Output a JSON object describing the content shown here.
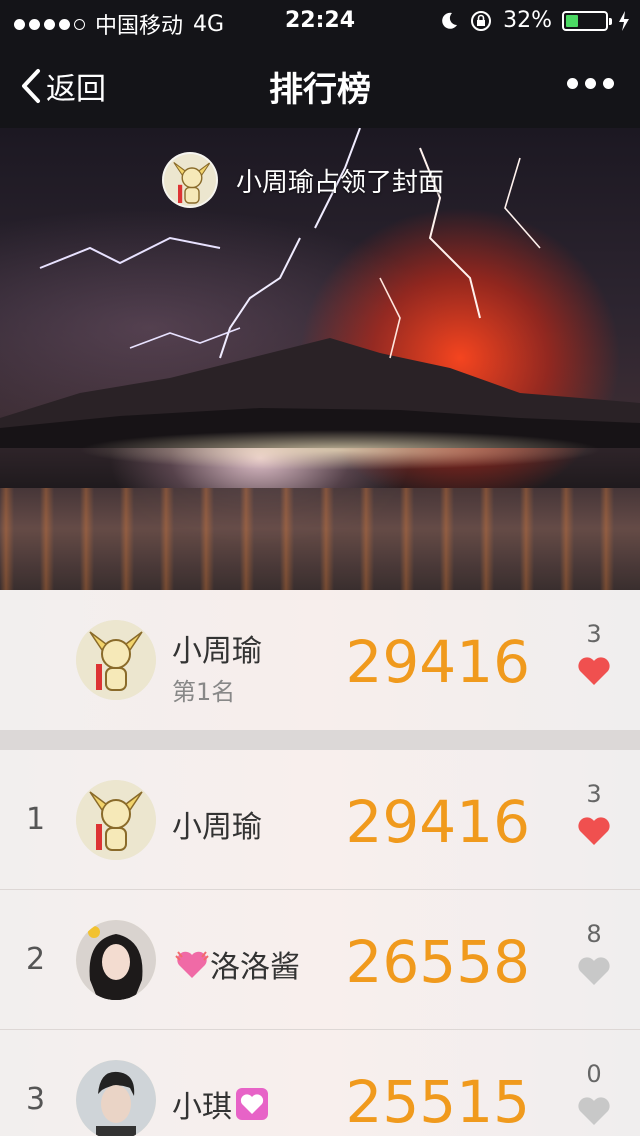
{
  "status": {
    "carrier": "中国移动",
    "network": "4G",
    "time": "22:24",
    "battery": "32%",
    "battery_level": 0.32,
    "battery_color": "#4cd964"
  },
  "nav": {
    "back_label": "返回",
    "title": "排行榜"
  },
  "cover": {
    "owner_text": "小周瑜占领了封面"
  },
  "mine": {
    "name": "小周瑜",
    "rank_text": "第1名",
    "score": "29416",
    "likes": "3",
    "liked": true
  },
  "ranking": [
    {
      "rank": "1",
      "name": "小周瑜",
      "score": "29416",
      "likes": "3",
      "liked": true,
      "avatar": "cartoon-avatar"
    },
    {
      "rank": "2",
      "name": "洛洛酱",
      "score": "26558",
      "likes": "8",
      "liked": false,
      "avatar": "girl-avatar"
    },
    {
      "rank": "3",
      "name": "小琪",
      "score": "25515",
      "likes": "0",
      "liked": false,
      "avatar": "man-avatar"
    }
  ],
  "colors": {
    "score": "#f09a1d",
    "heart_liked": "#f0504f",
    "heart_unliked": "#c8c8c8"
  }
}
